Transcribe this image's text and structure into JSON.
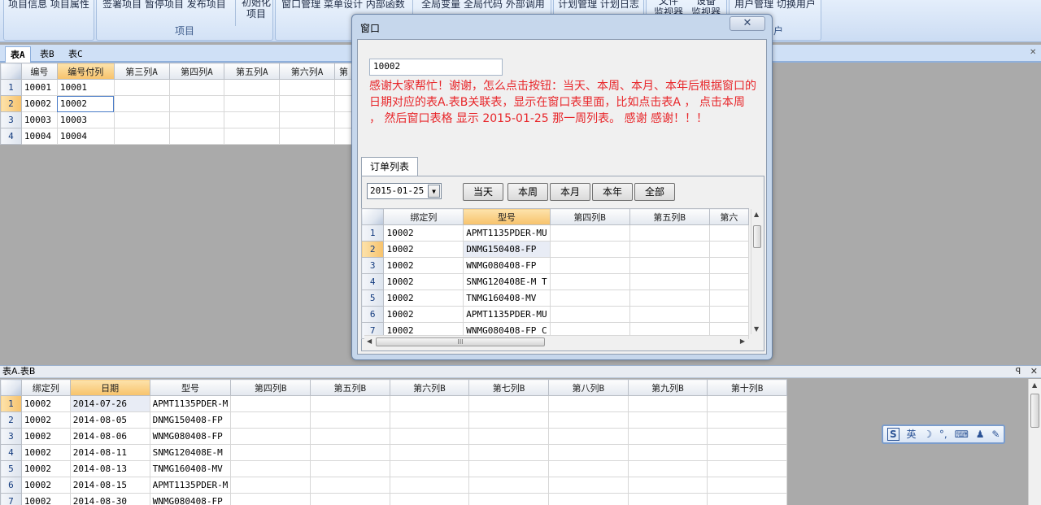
{
  "ribbon": {
    "groups": [
      {
        "items": "项目信息  项目属性",
        "caption": ""
      },
      {
        "items": "签署项目  暂停项目  发布项目",
        "caption": "项目"
      },
      {
        "items": "",
        "caption": ""
      },
      {
        "items": "窗口管理  菜单设计  内部函数",
        "caption": ""
      },
      {
        "items": "全局变量  全局代码  外部调用",
        "caption": ""
      },
      {
        "items": "计划管理  计划日志",
        "caption": ""
      },
      {
        "items": "",
        "caption": ""
      },
      {
        "items": "用户管理  切换用户",
        "caption": "户"
      }
    ],
    "init_button": "初始化\n项目",
    "monitor_buttons": [
      "文件\n监视器",
      "设备\n监视器"
    ]
  },
  "doc_tabs": [
    "表A",
    "表B",
    "表C"
  ],
  "table_a": {
    "columns": [
      "编号",
      "编号付列",
      "第三列A",
      "第四列A",
      "第五列A",
      "第六列A",
      "第"
    ],
    "rows": [
      {
        "num": "1",
        "c1": "10001",
        "c2": "10001"
      },
      {
        "num": "2",
        "c1": "10002",
        "c2": "10002"
      },
      {
        "num": "3",
        "c1": "10003",
        "c2": "10003"
      },
      {
        "num": "4",
        "c1": "10004",
        "c2": "10004"
      }
    ]
  },
  "dialog": {
    "title": "窗口",
    "close_glyph": "✕",
    "input_value": "10002",
    "message": "感谢大家帮忙！谢谢，怎么点击按钮：当天、本周、本月、本年后根据窗口的日期对应的表A.表B关联表，显示在窗口表里面，比如点击表A ， 点击本周 ， 然后窗口表格 显示 2015-01-25 那一周列表。  感谢 感谢！！！",
    "tab_label": "订单列表",
    "date_value": "2015-01-25",
    "buttons": [
      "当天",
      "本周",
      "本月",
      "本年",
      "全部"
    ],
    "grid_columns": [
      "绑定列",
      "型号",
      "第四列B",
      "第五列B",
      "第六"
    ],
    "grid_rows": [
      {
        "num": "1",
        "bind": "10002",
        "model": "APMT1135PDER-MU"
      },
      {
        "num": "2",
        "bind": "10002",
        "model": "DNMG150408-FP"
      },
      {
        "num": "3",
        "bind": "10002",
        "model": "WNMG080408-FP"
      },
      {
        "num": "4",
        "bind": "10002",
        "model": "SNMG120408E-M  T"
      },
      {
        "num": "5",
        "bind": "10002",
        "model": "TNMG160408-MV"
      },
      {
        "num": "6",
        "bind": "10002",
        "model": "APMT1135PDER-MU"
      },
      {
        "num": "7",
        "bind": "10002",
        "model": "WNMG080408-FP  C"
      }
    ],
    "hscroll_grip": "III"
  },
  "bottom_panel": {
    "title": "表A.表B",
    "pin_icon": "ꟼ",
    "close_icon": "✕",
    "columns": [
      "绑定列",
      "日期",
      "型号",
      "第四列B",
      "第五列B",
      "第六列B",
      "第七列B",
      "第八列B",
      "第九列B",
      "第十列B"
    ],
    "rows": [
      {
        "num": "1",
        "bind": "10002",
        "date": "2014-07-26",
        "model": "APMT1135PDER-M"
      },
      {
        "num": "2",
        "bind": "10002",
        "date": "2014-08-05",
        "model": "DNMG150408-FP"
      },
      {
        "num": "3",
        "bind": "10002",
        "date": "2014-08-06",
        "model": "WNMG080408-FP"
      },
      {
        "num": "4",
        "bind": "10002",
        "date": "2014-08-11",
        "model": "SNMG120408E-M"
      },
      {
        "num": "5",
        "bind": "10002",
        "date": "2014-08-13",
        "model": "TNMG160408-MV"
      },
      {
        "num": "6",
        "bind": "10002",
        "date": "2014-08-15",
        "model": "APMT1135PDER-M"
      },
      {
        "num": "7",
        "bind": "10002",
        "date": "2014-08-30",
        "model": "WNMG080408-FP"
      }
    ]
  },
  "ime_bar": {
    "items": [
      "英",
      "☽",
      "°,",
      "⌨",
      "♟",
      "✎"
    ],
    "logo": "S"
  }
}
